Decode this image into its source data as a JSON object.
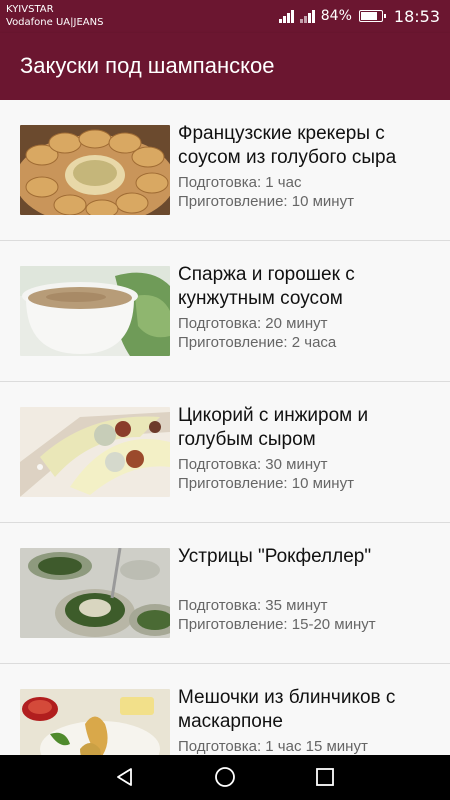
{
  "status": {
    "carrier_line1": "KYIVSTAR",
    "carrier_line2": "Vodafone UA|JEANS",
    "battery_text": "84%",
    "battery_level": 0.84,
    "time": "18:53"
  },
  "app_bar": {
    "title": "Закуски под шампанское"
  },
  "recipes": [
    {
      "title": "Французские крекеры с соусом из голубого сыра",
      "prep": "Подготовка: 1 час",
      "cook": "Приготовление: 10 минут",
      "image": "crackers-blue-cheese-photo"
    },
    {
      "title": "Спаржа и горошек с кунжутным соусом",
      "prep": "Подготовка: 20 минут",
      "cook": "Приготовление: 2 часа",
      "image": "asparagus-peas-sesame-photo"
    },
    {
      "title": "Цикорий с инжиром и голубым сыром",
      "prep": "Подготовка: 30 минут",
      "cook": "Приготовление: 10 минут",
      "image": "chicory-fig-cheese-photo"
    },
    {
      "title": "Устрицы \"Рокфеллер\"",
      "prep": "Подготовка: 35 минут",
      "cook": "Приготовление: 15-20 минут",
      "image": "oysters-rockefeller-photo"
    },
    {
      "title": "Мешочки из блинчиков с маскарпоне",
      "prep": "Подготовка: 1 час 15 минут",
      "cook": "",
      "image": "crepe-pouches-mascarpone-photo"
    }
  ],
  "nav": {
    "back": "back-icon",
    "home": "home-icon",
    "recent": "recent-apps-icon"
  },
  "colors": {
    "primary": "#6b1630",
    "background": "#f8f8f8",
    "text": "#111111",
    "secondary_text": "#666666"
  }
}
